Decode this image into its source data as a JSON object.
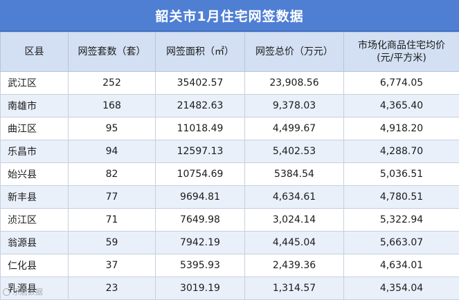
{
  "title": "韶关市1月住宅网签数据",
  "headers": [
    "区县",
    "网签套数（套）",
    "网签面积（㎡）",
    "网签总价（万元）",
    "市场化商品住宅均价\n(元/平方米)"
  ],
  "rows": [
    [
      "武江区",
      "252",
      "35402.57",
      "23,908.56",
      "6,774.05"
    ],
    [
      "南雄市",
      "168",
      "21482.63",
      "9,378.03",
      "4,365.40"
    ],
    [
      "曲江区",
      "95",
      "11018.49",
      "4,499.67",
      "4,918.20"
    ],
    [
      "乐昌市",
      "94",
      "12597.13",
      "5,402.53",
      "4,288.70"
    ],
    [
      "始兴县",
      "82",
      "10754.69",
      "5384.54",
      "5,036.51"
    ],
    [
      "新丰县",
      "77",
      "9694.81",
      "4,634.61",
      "4,780.51"
    ],
    [
      "浈江区",
      "71",
      "7649.98",
      "3,024.14",
      "5,322.94"
    ],
    [
      "翁源县",
      "59",
      "7942.19",
      "4,445.04",
      "5,663.07"
    ],
    [
      "仁化县",
      "37",
      "5395.93",
      "2,439.36",
      "4,634.01"
    ],
    [
      "乳源县",
      "23",
      "3019.19",
      "1,314.57",
      "4,354.04"
    ]
  ],
  "watermark": "乐居数据",
  "colors": {
    "title_bg": "#4f7fd3",
    "header_bg": "#d3e0f3",
    "stripe_bg": "#eaf0fa"
  }
}
